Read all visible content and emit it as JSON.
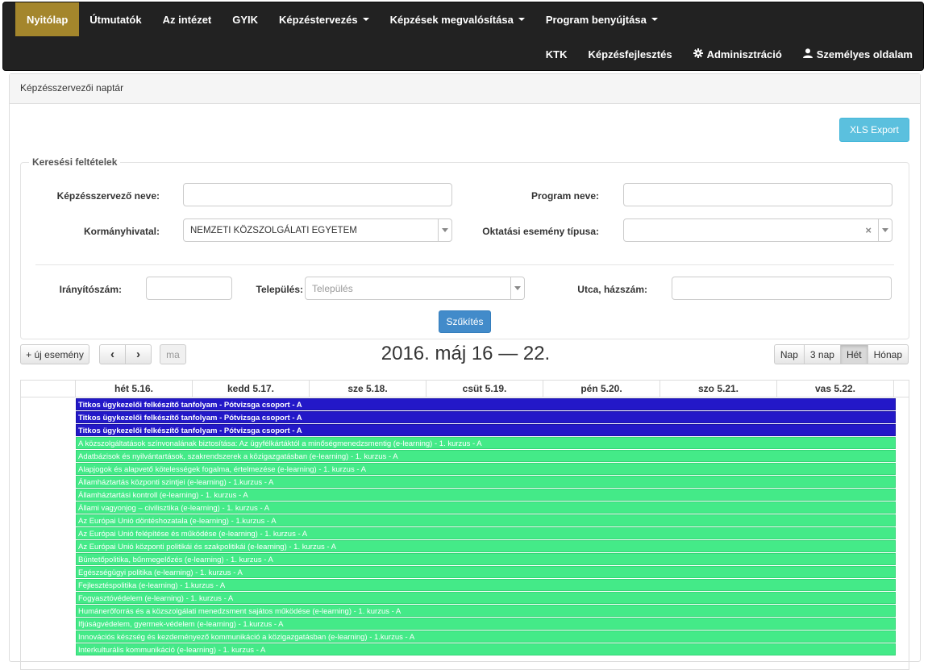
{
  "nav": {
    "row1": [
      {
        "label": "Nyitólap",
        "active": true,
        "dropdown": false
      },
      {
        "label": "Útmutatók",
        "dropdown": false
      },
      {
        "label": "Az intézet",
        "dropdown": false
      },
      {
        "label": "GYIK",
        "dropdown": false
      },
      {
        "label": "Képzéstervezés",
        "dropdown": true
      },
      {
        "label": "Képzések megvalósítása",
        "dropdown": true
      },
      {
        "label": "Program benyújtása",
        "dropdown": true
      }
    ],
    "row2": {
      "ktk": "KTK",
      "kepzesfejlesztes": "Képzésfejlesztés",
      "admin": "Adminisztráció",
      "personal": "Személyes oldalam"
    }
  },
  "panel": {
    "heading": "Képzésszervezői naptár",
    "xls_export": "XLS Export"
  },
  "search": {
    "legend": "Keresési feltételek",
    "organizer_label": "Képzésszervező neve:",
    "organizer_value": "",
    "program_label": "Program neve:",
    "program_value": "",
    "office_label": "Kormányhivatal:",
    "office_value": "NEMZETI KÖZSZOLGÁLATI EGYETEM",
    "event_type_label": "Oktatási esemény típusa:",
    "event_type_value": "",
    "zip_label": "Irányítószám:",
    "zip_value": "",
    "city_label": "Település:",
    "city_placeholder": "Település",
    "street_label": "Utca, házszám:",
    "street_value": "",
    "submit": "Szűkítés"
  },
  "calendar": {
    "new_event": "+ új esemény",
    "prev": "‹",
    "next": "›",
    "today": "ma",
    "title": "2016. máj 16 — 22.",
    "views": [
      "Nap",
      "3 nap",
      "Hét",
      "Hónap"
    ],
    "active_view": "Hét",
    "days": [
      "hét 5.16.",
      "kedd 5.17.",
      "sze 5.18.",
      "csüt 5.19.",
      "pén 5.20.",
      "szo 5.21.",
      "vas 5.22."
    ],
    "colors": {
      "exam": "#2318c8",
      "elearning": "#44ea88"
    },
    "events": [
      {
        "title": "Titkos ügykezelői felkészítő tanfolyam - Pótvizsga csoport - A",
        "kind": "exam"
      },
      {
        "title": "Titkos ügykezelői felkészítő tanfolyam - Pótvizsga csoport - A",
        "kind": "exam"
      },
      {
        "title": "Titkos ügykezelői felkészítő tanfolyam - Pótvizsga csoport - A",
        "kind": "exam"
      },
      {
        "title": "A közszolgáltatások színvonalának biztosítása: Az ügyfélkártáktól a minőségmenedzsmentig (e-learning) - 1. kurzus - A",
        "kind": "elearning"
      },
      {
        "title": "Adatbázisok és nyilvántartások, szakrendszerek a közigazgatásban (e-learning) - 1. kurzus - A",
        "kind": "elearning"
      },
      {
        "title": "Alapjogok és alapvető kötelességek fogalma, értelmezése (e-learning) - 1. kurzus - A",
        "kind": "elearning"
      },
      {
        "title": "Államháztartás központi szintjei (e-learning) - 1.kurzus - A",
        "kind": "elearning"
      },
      {
        "title": "Államháztartási kontroll (e-learning) - 1. kurzus - A",
        "kind": "elearning"
      },
      {
        "title": "Állami vagyonjog – civilisztika (e-learning) - 1. kurzus - A",
        "kind": "elearning"
      },
      {
        "title": "Az Európai Unió döntéshozatala (e-learning) - 1.kurzus - A",
        "kind": "elearning"
      },
      {
        "title": "Az Európai Unió felépítése és működése (e-learning) - 1. kurzus - A",
        "kind": "elearning"
      },
      {
        "title": "Az Európai Unió központi politikái és szakpolitikái (e-learning) - 1. kurzus - A",
        "kind": "elearning"
      },
      {
        "title": "Büntetőpolitika, bűnmegelőzés (e-learning) - 1. kurzus - A",
        "kind": "elearning"
      },
      {
        "title": "Egészségügyi politika (e-learning) - 1. kurzus - A",
        "kind": "elearning"
      },
      {
        "title": "Fejlesztéspolitika (e-learning) - 1.kurzus - A",
        "kind": "elearning"
      },
      {
        "title": "Fogyasztóvédelem (e-learning) - 1. kurzus - A",
        "kind": "elearning"
      },
      {
        "title": "Humánerőforrás és a közszolgálati menedzsment sajátos működése (e-learning) - 1. kurzus - A",
        "kind": "elearning"
      },
      {
        "title": "Ifjúságvédelem, gyermek-védelem (e-learning) - 1.kurzus - A",
        "kind": "elearning"
      },
      {
        "title": "Innovációs készség és kezdeményező kommunikáció a közigazgatásban (e-learning) - 1.kurzus - A",
        "kind": "elearning"
      },
      {
        "title": "Interkulturális kommunikáció (e-learning) - 1. kurzus - A",
        "kind": "elearning"
      }
    ]
  }
}
